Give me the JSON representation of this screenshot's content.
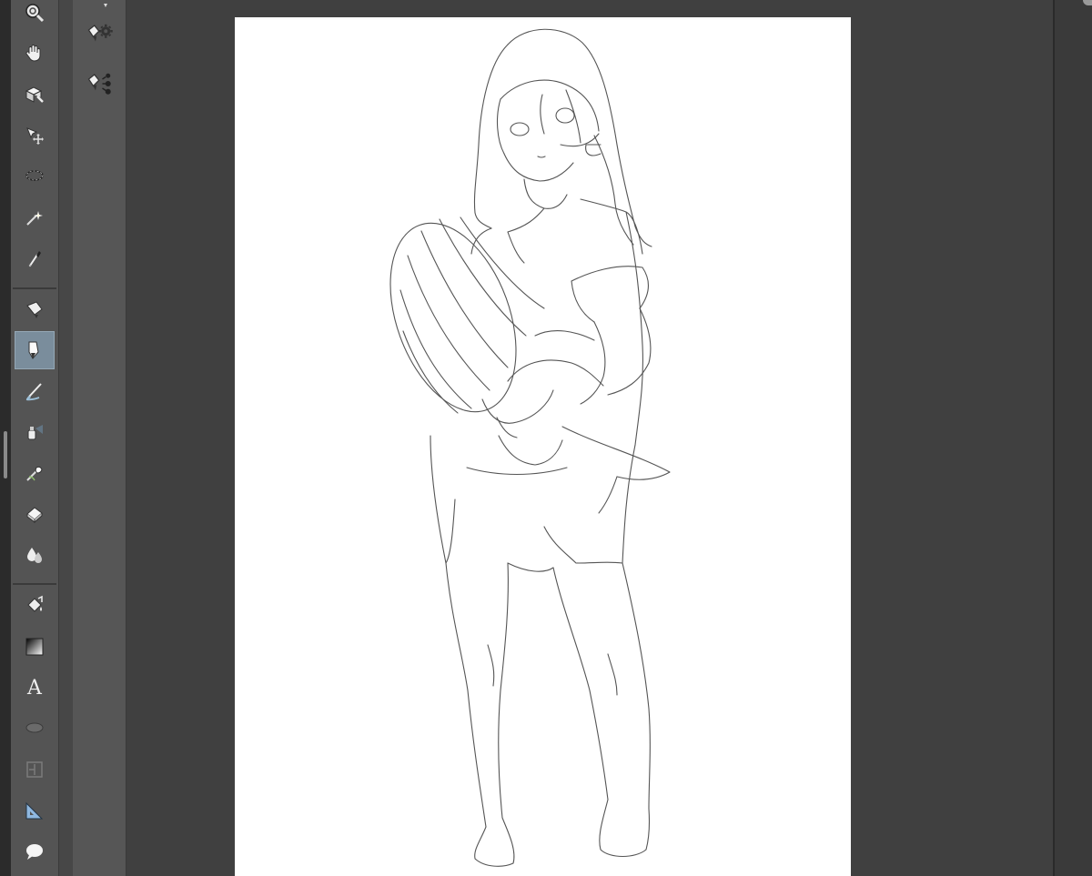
{
  "app": {
    "accent_color": "#7a8d9c",
    "canvas_bg": "#404040",
    "paper_color": "#ffffff"
  },
  "toolbar": {
    "tools": [
      {
        "id": "zoom",
        "icon": "zoom-icon",
        "active": false
      },
      {
        "id": "hand",
        "icon": "hand-icon",
        "active": false
      },
      {
        "id": "operation",
        "icon": "operation-icon",
        "active": false
      },
      {
        "id": "move-layer",
        "icon": "move-layer-icon",
        "active": false
      },
      {
        "id": "selection",
        "icon": "lasso-selection-icon",
        "active": false
      },
      {
        "id": "auto-select",
        "icon": "magic-wand-icon",
        "active": false
      },
      {
        "id": "eyedropper",
        "icon": "eyedropper-icon",
        "active": false
      },
      {
        "id": "pen",
        "icon": "pen-icon",
        "active": false
      },
      {
        "id": "pencil",
        "icon": "pencil-icon",
        "active": true
      },
      {
        "id": "brush",
        "icon": "brush-icon",
        "active": false
      },
      {
        "id": "airbrush",
        "icon": "airbrush-icon",
        "active": false
      },
      {
        "id": "decoration",
        "icon": "decoration-icon",
        "active": false
      },
      {
        "id": "eraser",
        "icon": "eraser-icon",
        "active": false
      },
      {
        "id": "blend",
        "icon": "blend-icon",
        "active": false
      },
      {
        "id": "fill",
        "icon": "fill-bucket-icon",
        "active": false
      },
      {
        "id": "gradient",
        "icon": "gradient-icon",
        "active": false
      },
      {
        "id": "text",
        "icon": "text-icon",
        "active": false
      },
      {
        "id": "balloon",
        "icon": "balloon-icon",
        "active": false
      },
      {
        "id": "frame-border",
        "icon": "frame-border-icon",
        "active": false
      },
      {
        "id": "ruler",
        "icon": "ruler-icon",
        "active": false
      },
      {
        "id": "speech",
        "icon": "speech-bubble-icon",
        "active": false
      }
    ],
    "text_tool_glyph": "A"
  },
  "subtool_panel": {
    "items": [
      {
        "id": "subtool-settings",
        "icon": "pen-settings-icon"
      },
      {
        "id": "subtool-detail",
        "icon": "pen-detail-icon"
      }
    ]
  },
  "canvas": {
    "description_icon": "canvas-icon"
  }
}
